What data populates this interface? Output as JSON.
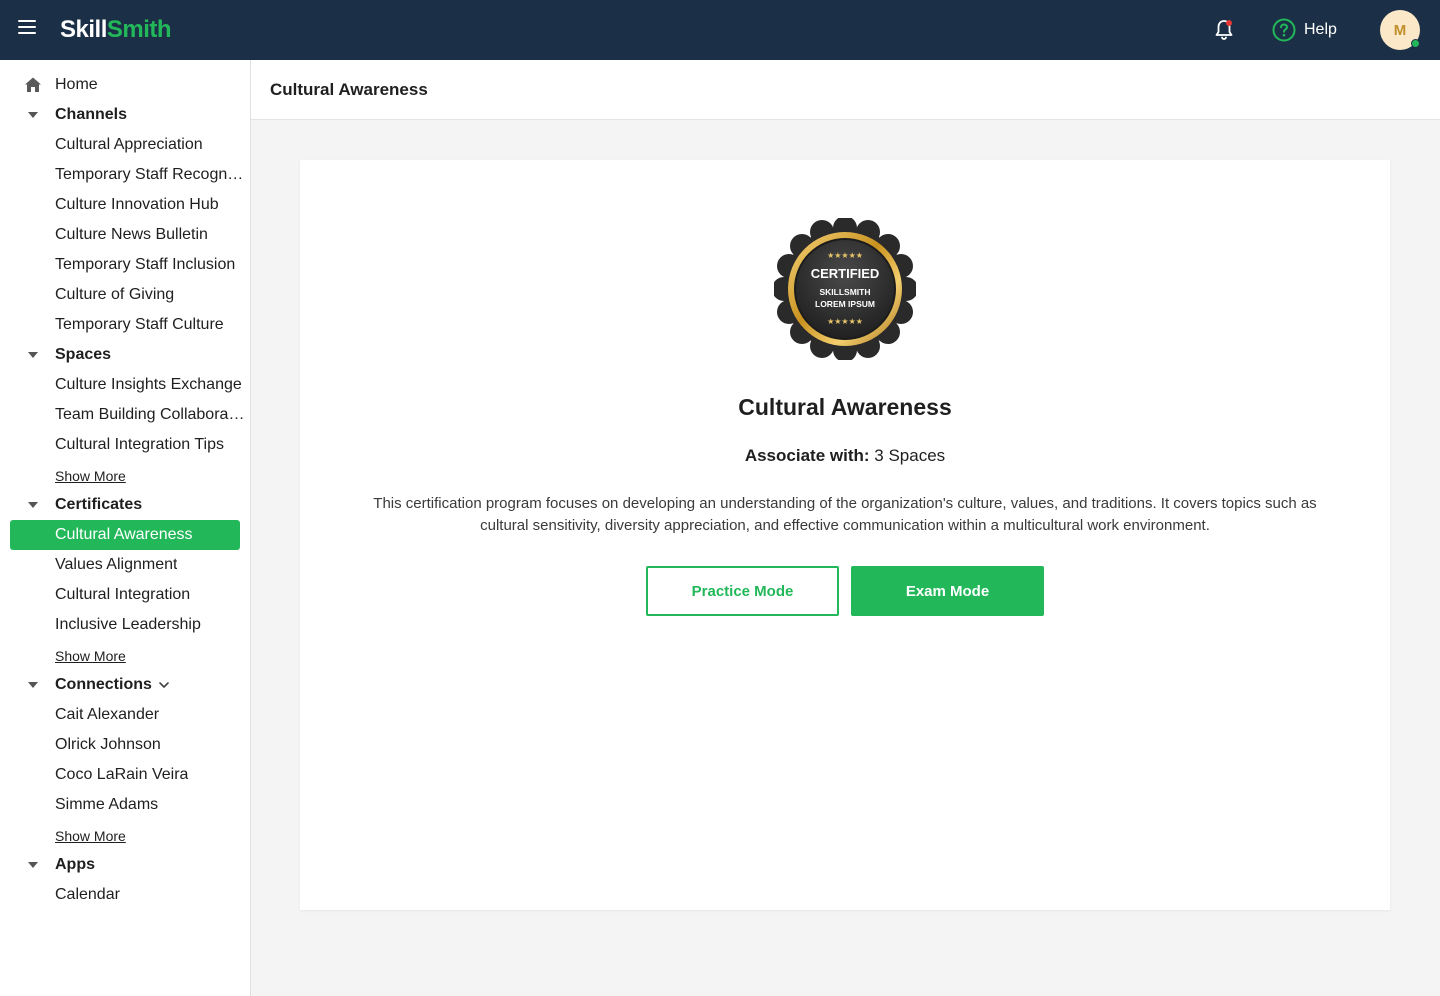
{
  "app": {
    "logo_part1": "Skill",
    "logo_part2": "Smith",
    "help_label": "Help",
    "avatar_initial": "M"
  },
  "colors": {
    "topbar": "#1b3047",
    "accent": "#22b85a",
    "notification_dot": "#e53935"
  },
  "sidebar": {
    "home": "Home",
    "channels": {
      "title": "Channels",
      "items": [
        "Cultural Appreciation",
        "Temporary Staff Recognition",
        "Culture Innovation Hub",
        "Culture News Bulletin",
        "Temporary Staff Inclusion",
        "Culture of Giving",
        "Temporary Staff Culture"
      ]
    },
    "spaces": {
      "title": "Spaces",
      "items": [
        "Culture Insights Exchange",
        "Team Building Collaboration",
        "Cultural Integration Tips"
      ],
      "show_more": "Show More"
    },
    "certificates": {
      "title": "Certificates",
      "items": [
        "Cultural Awareness",
        "Values Alignment",
        "Cultural Integration",
        "Inclusive Leadership"
      ],
      "show_more": "Show More"
    },
    "connections": {
      "title": "Connections",
      "items": [
        "Cait Alexander",
        "Olrick Johnson",
        "Coco LaRain Veira",
        "Simme Adams"
      ],
      "show_more": "Show More"
    },
    "apps": {
      "title": "Apps",
      "items": [
        "Calendar"
      ]
    }
  },
  "main": {
    "header_title": "Cultural Awareness",
    "badge": {
      "line1": "CERTIFIED",
      "line2": "SKILLSMITH",
      "line3": "LOREM IPSUM"
    },
    "certificate_title": "Cultural Awareness",
    "associate_label": "Associate with:",
    "associate_value": "3 Spaces",
    "description": "This certification program focuses on developing an understanding of the organization's culture, values, and traditions. It covers topics such as cultural sensitivity, diversity appreciation, and effective communication within a multicultural work environment.",
    "practice_button": "Practice Mode",
    "exam_button": "Exam Mode"
  }
}
